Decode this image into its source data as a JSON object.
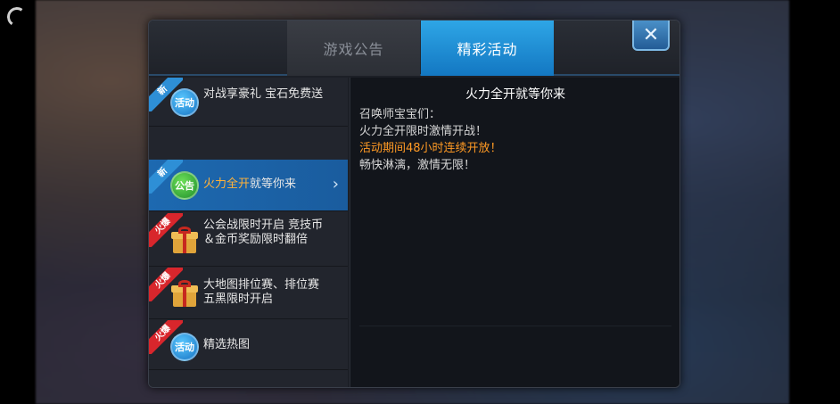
{
  "tabs": {
    "notice": "游戏公告",
    "events": "精彩活动"
  },
  "close_icon": "close-icon",
  "sidebar": {
    "items": [
      {
        "tag": "新",
        "tag_type": "new",
        "badge": "活动",
        "badge_color": "blue",
        "label": "对战享豪礼 宝石免费送"
      },
      {
        "tag": "新",
        "tag_type": "new",
        "badge": "公告",
        "badge_color": "green",
        "label_highlight": "火力全开",
        "label_rest": "就等你来",
        "selected": true
      },
      {
        "tag": "火爆",
        "tag_type": "hot",
        "badge": "gift-icon",
        "label": "公会战限时开启 竞技币＆金币奖励限时翻倍"
      },
      {
        "tag": "火爆",
        "tag_type": "hot",
        "badge": "gift-icon",
        "label": "大地图排位赛、排位赛五黑限时开启"
      },
      {
        "tag": "火爆",
        "tag_type": "hot",
        "badge": "活动",
        "badge_color": "blue",
        "label": "精选热图"
      }
    ]
  },
  "content": {
    "title": "火力全开就等你来",
    "lines": [
      {
        "text": "召唤师宝宝们：",
        "color": "#d6d6d6"
      },
      {
        "text": "火力全开限时激情开战！",
        "color": "#d6d6d6"
      },
      {
        "text": "活动期间48小时连续开放！",
        "color": "#ff9a24"
      },
      {
        "text": "畅快淋漓，激情无限！",
        "color": "#d6d6d6"
      }
    ]
  },
  "colors": {
    "accent_blue": "#1a78c2",
    "highlight_orange": "#ff9a24",
    "hot_red": "#d8262c"
  }
}
